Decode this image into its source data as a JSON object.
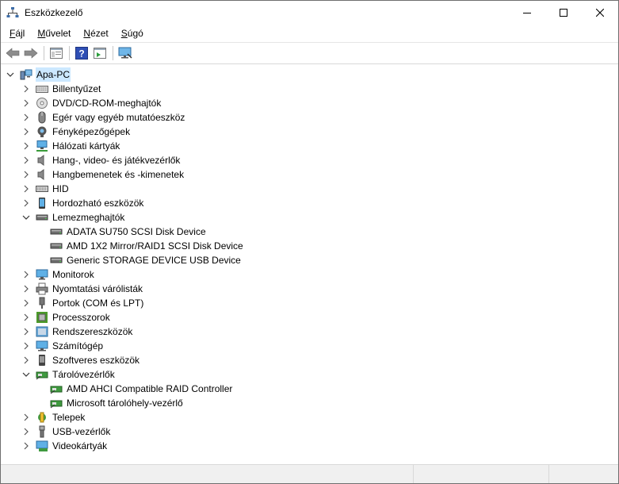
{
  "window": {
    "title": "Eszközkezelő"
  },
  "menu": [
    {
      "key": "F",
      "rest": "ájl"
    },
    {
      "key": "M",
      "rest": "űvelet"
    },
    {
      "key": "N",
      "rest": "ézet"
    },
    {
      "key": "S",
      "rest": "úgó"
    }
  ],
  "tree": {
    "root": "Apa-PC",
    "categories": [
      {
        "label": "Billentyűzet",
        "icon": "keyboard-icon",
        "expanded": false
      },
      {
        "label": "DVD/CD-ROM-meghajtók",
        "icon": "disc-drive-icon",
        "expanded": false
      },
      {
        "label": "Egér vagy egyéb mutatóeszköz",
        "icon": "mouse-icon",
        "expanded": false
      },
      {
        "label": "Fényképezőgépek",
        "icon": "camera-icon",
        "expanded": false
      },
      {
        "label": "Hálózati kártyák",
        "icon": "network-adapter-icon",
        "expanded": false
      },
      {
        "label": "Hang-, video- és játékvezérlők",
        "icon": "speaker-icon",
        "expanded": false
      },
      {
        "label": "Hangbemenetek és -kimenetek",
        "icon": "speaker-icon",
        "expanded": false
      },
      {
        "label": "HID",
        "icon": "hid-icon",
        "expanded": false
      },
      {
        "label": "Hordozható eszközök",
        "icon": "portable-device-icon",
        "expanded": false
      },
      {
        "label": "Lemezmeghajtók",
        "icon": "disk-drive-icon",
        "expanded": true,
        "children": [
          "ADATA SU750 SCSI Disk Device",
          "AMD 1X2 Mirror/RAID1 SCSI Disk Device",
          "Generic STORAGE DEVICE USB Device"
        ],
        "child_icon": "disk-drive-icon"
      },
      {
        "label": "Monitorok",
        "icon": "monitor-icon",
        "expanded": false
      },
      {
        "label": "Nyomtatási várólisták",
        "icon": "printer-icon",
        "expanded": false
      },
      {
        "label": "Portok (COM és LPT)",
        "icon": "port-icon",
        "expanded": false
      },
      {
        "label": "Processzorok",
        "icon": "processor-icon",
        "expanded": false
      },
      {
        "label": "Rendszereszközök",
        "icon": "system-device-icon",
        "expanded": false
      },
      {
        "label": "Számítógép",
        "icon": "computer-icon",
        "expanded": false
      },
      {
        "label": "Szoftveres eszközök",
        "icon": "software-device-icon",
        "expanded": false
      },
      {
        "label": "Tárolóvezérlők",
        "icon": "storage-controller-icon",
        "expanded": true,
        "children": [
          "AMD AHCI Compatible RAID Controller",
          "Microsoft tárolóhely-vezérlő"
        ],
        "child_icon": "storage-controller-icon"
      },
      {
        "label": "Telepek",
        "icon": "battery-icon",
        "expanded": false
      },
      {
        "label": "USB-vezérlők",
        "icon": "usb-icon",
        "expanded": false
      },
      {
        "label": "Videokártyák",
        "icon": "display-adapter-icon",
        "expanded": false
      }
    ]
  }
}
